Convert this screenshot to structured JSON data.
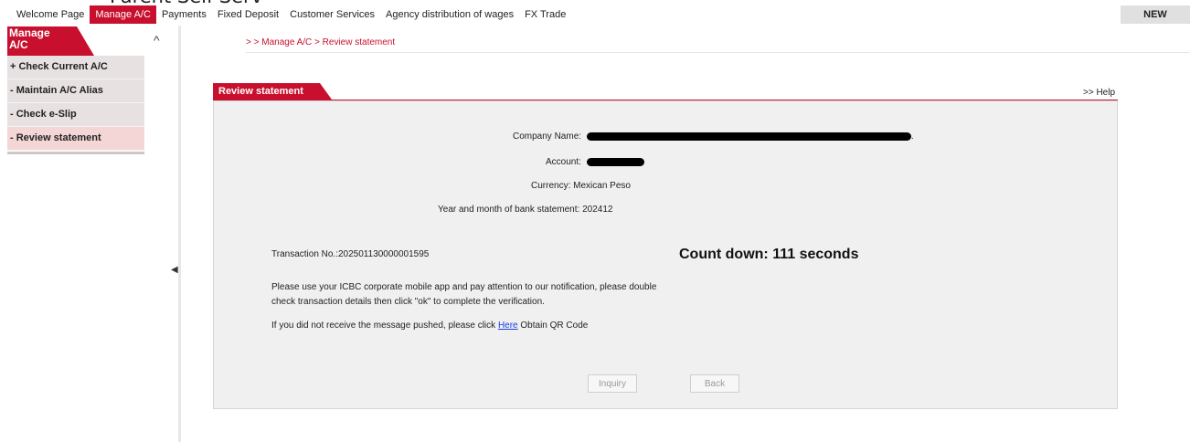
{
  "header": {
    "clipped_title": "Parent Self-Serv",
    "new_badge": "NEW",
    "menu": [
      {
        "label": "Welcome Page"
      },
      {
        "label": "Manage A/C"
      },
      {
        "label": "Payments"
      },
      {
        "label": "Fixed Deposit"
      },
      {
        "label": "Customer Services"
      },
      {
        "label": "Agency distribution of wages"
      },
      {
        "label": "FX Trade"
      }
    ]
  },
  "sidebar": {
    "title_line1": "Manage",
    "title_line2": "A/C",
    "collapse_glyph": "^",
    "items": [
      {
        "label": "+ Check Current A/C"
      },
      {
        "label": "- Maintain A/C Alias"
      },
      {
        "label": "- Check e-Slip"
      },
      {
        "label": "- Review statement"
      }
    ]
  },
  "breadcrumb": "> > Manage A/C > Review statement",
  "panel": {
    "tab_label": "Review statement",
    "help_label": ">> Help",
    "company_label": "Company Name:",
    "account_label": "Account:",
    "currency_label": "Currency:",
    "currency_value": "Mexican Peso",
    "statement_label": "Year and month of bank statement:",
    "statement_value": "202412",
    "transaction_label": "Transaction No.:",
    "transaction_value": "202501130000001595",
    "countdown": "Count down: 111 seconds",
    "notice": "Please use your ICBC corporate mobile app and pay attention to our notification, please double check transaction details then click \"ok\" to complete the verification.",
    "qr_prefix": "If you did not receive the message pushed, please click",
    "qr_link": "Here",
    "qr_suffix": "Obtain QR Code",
    "buttons": {
      "inquiry": "Inquiry",
      "back": "Back"
    }
  },
  "colors": {
    "accent": "#c8102e",
    "panel_bg": "#f0f0f0",
    "link": "#1a3ee0"
  }
}
